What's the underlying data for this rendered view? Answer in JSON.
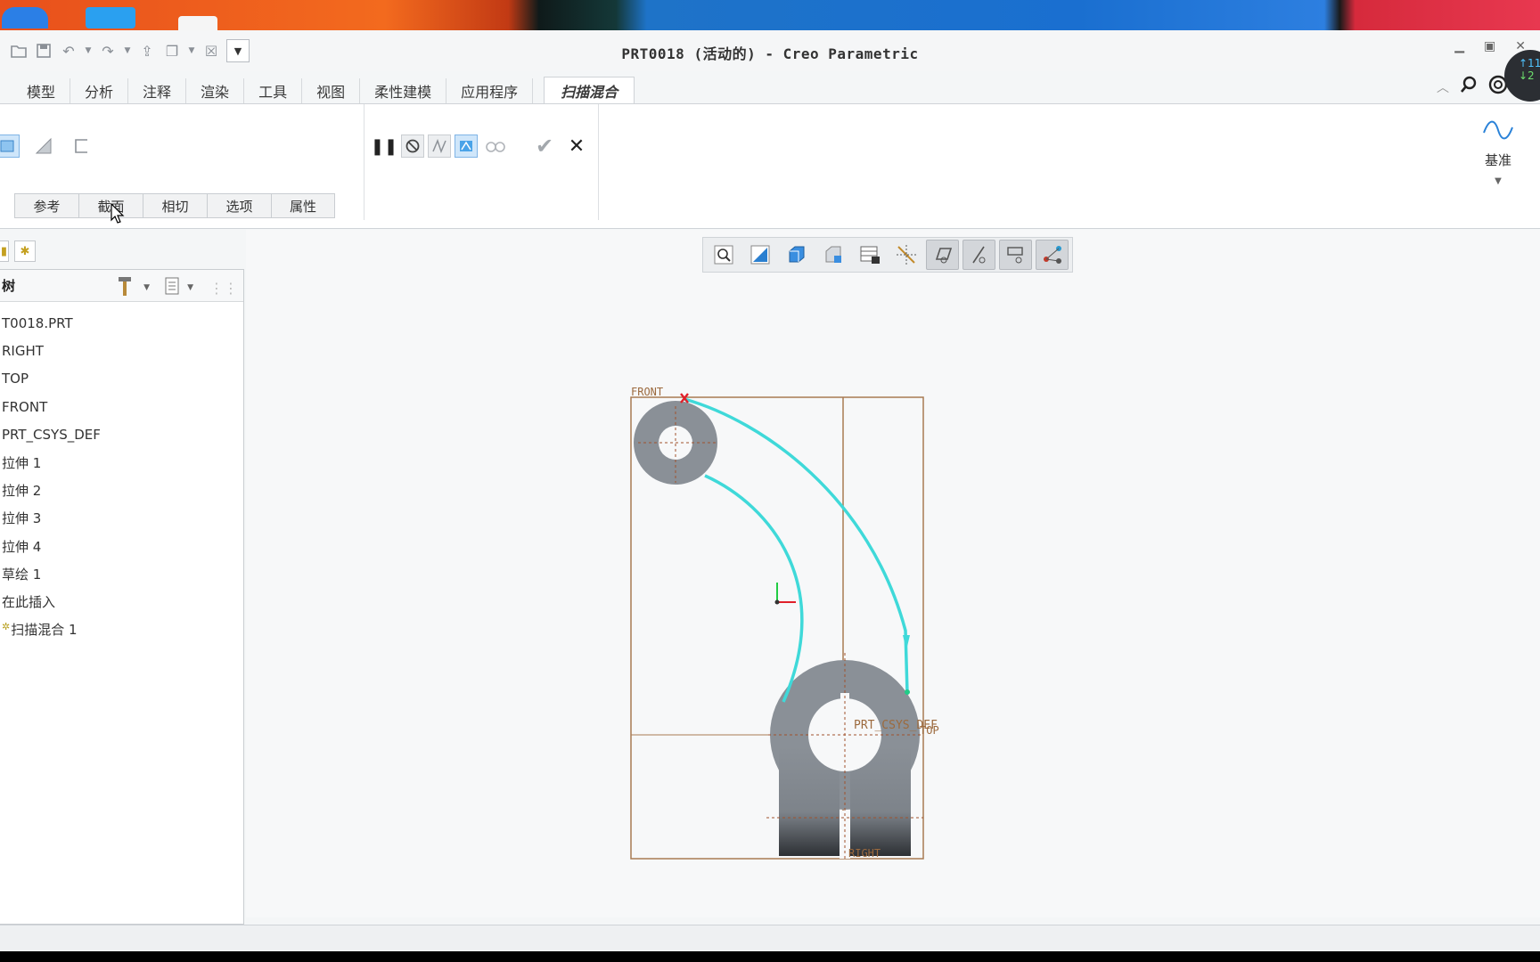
{
  "window": {
    "title": "PRT0018 (活动的) - Creo Parametric"
  },
  "ribbon": {
    "tabs": [
      "模型",
      "分析",
      "注释",
      "渲染",
      "工具",
      "视图",
      "柔性建模",
      "应用程序"
    ],
    "active_tab": "扫描混合",
    "subtabs": [
      "参考",
      "截面",
      "相切",
      "选项",
      "属性"
    ],
    "datum_label": "基准"
  },
  "notifications": {
    "up": "↑11",
    "down": "↓2"
  },
  "model_tree": {
    "header": "树",
    "items": [
      "T0018.PRT",
      "RIGHT",
      "TOP",
      "FRONT",
      "PRT_CSYS_DEF",
      "拉伸 1",
      "拉伸 2",
      "拉伸 3",
      "拉伸 4",
      "草绘 1",
      "在此插入",
      "扫描混合 1"
    ]
  },
  "graphics": {
    "labels": {
      "front": "FRONT",
      "csys": "PRT_CSYS_DEF",
      "top": "TOP",
      "right": "RIGHT"
    },
    "colors": {
      "datum": "#9c6a3e",
      "trajectory": "#3fd9d9",
      "solid": "#8a9097",
      "highlight_blue": "#7fb4e6"
    }
  }
}
